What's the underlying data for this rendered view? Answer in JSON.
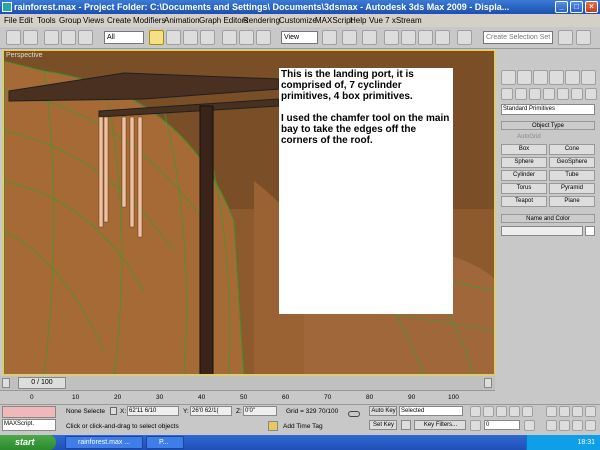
{
  "window": {
    "title": "rainforest.max    - Project Folder: C:\\Documents and Settings\\                   Documents\\3dsmax    - Autodesk 3ds Max  2009       - Displa..."
  },
  "menu": {
    "items": [
      "File",
      "Edit",
      "Tools",
      "Group",
      "Views",
      "Create",
      "Modifiers",
      "Animation",
      "Graph Editors",
      "Rendering",
      "Customize",
      "MAXScript",
      "Help",
      "Vue 7 xStream"
    ]
  },
  "toolbar": {
    "filter_select": "All",
    "view_select": "View",
    "selection_set_placeholder": "Create Selection Set"
  },
  "viewport": {
    "label": "Perspective"
  },
  "note": {
    "paragraph1": "This is the landing port, it is comprised of, 7 cyclinder primitives, 4 box primitives.",
    "paragraph2": "I used the chamfer tool on the main bay to take the edges off the corners of the roof."
  },
  "command_panel": {
    "category_select": "Standard Primitives",
    "object_type_header": "Object Type",
    "autogrid_label": "AutoGrid",
    "buttons": [
      "Box",
      "Cone",
      "Sphere",
      "GeoSphere",
      "Cylinder",
      "Tube",
      "Torus",
      "Pyramid",
      "Teapot",
      "Plane"
    ],
    "name_color_header": "Name and Color"
  },
  "timeline": {
    "frame": "0 / 100"
  },
  "track": {
    "ticks": [
      "0",
      "10",
      "20",
      "30",
      "40",
      "50",
      "60",
      "70",
      "80",
      "90",
      "100"
    ]
  },
  "status": {
    "maxscript_label": "MAXScript.",
    "selection_count": "None Selecte",
    "x_label": "X:",
    "x_value": "62'11 6/10",
    "y_label": "Y:",
    "y_value": "26'0 62/1(",
    "z_label": "Z:",
    "z_value": "0'0\"",
    "grid": "Grid = 329 70/100",
    "auto_key": "Auto Key",
    "key_mode_select": "Selected",
    "set_key": "Set Key",
    "key_filters": "Key Filters...",
    "frame_field": "0",
    "prompt": "Click or click-and-drag to select objects",
    "add_time_tag": "Add Time Tag"
  },
  "taskbar": {
    "start_label": "start",
    "tasks": [
      "rainforest.max ...",
      "P..."
    ],
    "clock": "18:31"
  }
}
